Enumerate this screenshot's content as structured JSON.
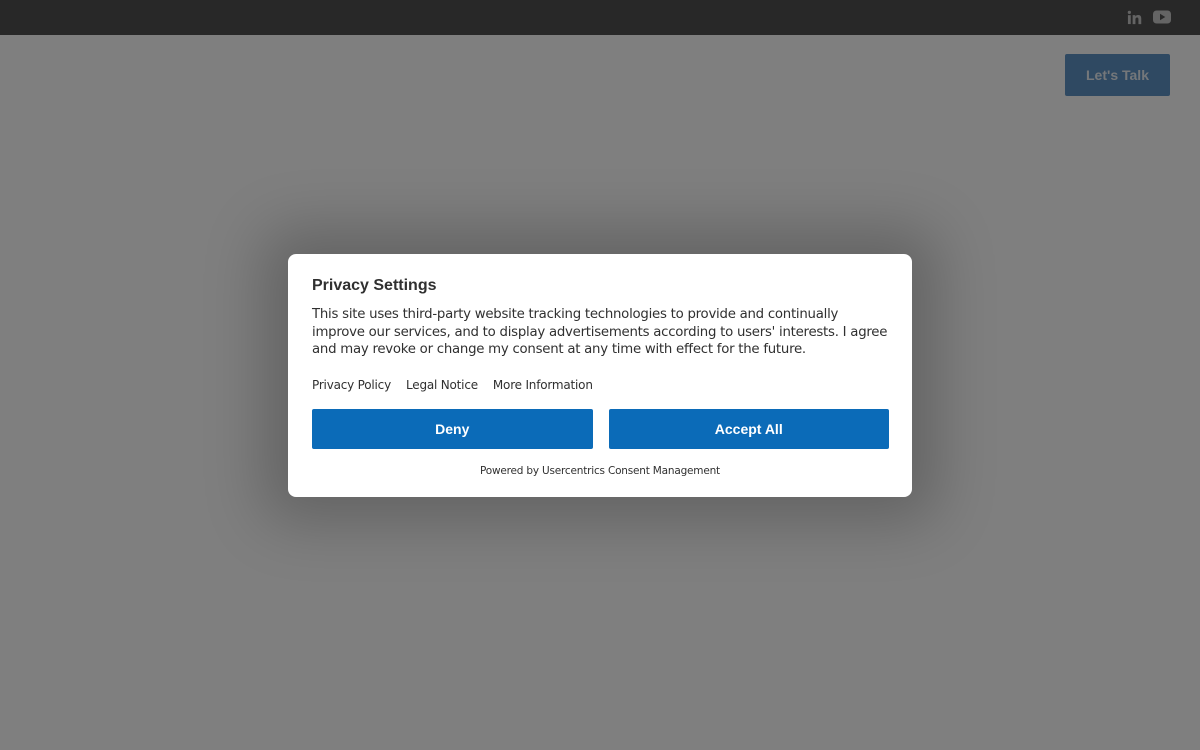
{
  "header": {
    "cta_label": "Let's Talk"
  },
  "social": {
    "linkedin_icon": "linkedin-icon",
    "youtube_icon": "youtube-icon"
  },
  "consent": {
    "title": "Privacy Settings",
    "description": "This site uses third-party website tracking technologies to provide and continually improve our services, and to display advertisements according to users' interests. I agree and may revoke or change my consent at any time with effect for the future.",
    "links": {
      "privacy_policy": "Privacy Policy",
      "legal_notice": "Legal Notice",
      "more_information": "More Information"
    },
    "deny_label": "Deny",
    "accept_label": "Accept All",
    "powered_by": "Powered by Usercentrics Consent Management"
  },
  "colors": {
    "topbar": "#515151",
    "accent": "#0b6bb8",
    "cta": "#5f93c4",
    "overlay": "rgba(0,0,0,0.5)"
  }
}
